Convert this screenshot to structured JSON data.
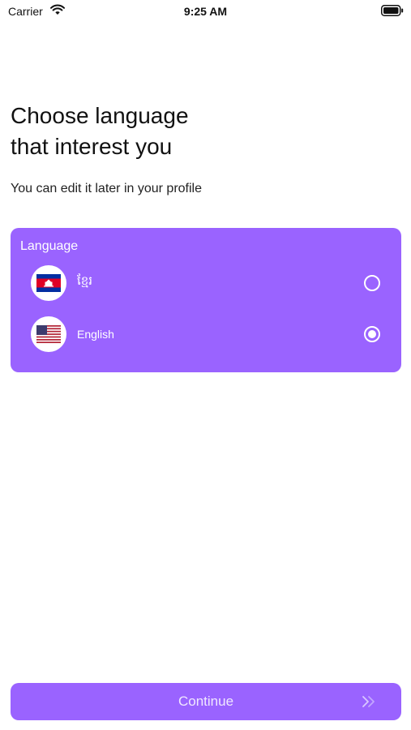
{
  "status_bar": {
    "carrier": "Carrier",
    "time": "9:25 AM"
  },
  "header": {
    "title_line1": "Choose language",
    "title_line2": "that interest you",
    "subtitle": "You can edit it later in your profile"
  },
  "language_card": {
    "label": "Language",
    "items": [
      {
        "name": "ខ្មែរ",
        "flag": "cambodia-flag",
        "selected": false
      },
      {
        "name": "English",
        "flag": "usa-flag",
        "selected": true
      }
    ]
  },
  "continue_button": {
    "label": "Continue"
  },
  "colors": {
    "accent": "#9a63ff",
    "text": "#111111",
    "background": "#ffffff"
  }
}
